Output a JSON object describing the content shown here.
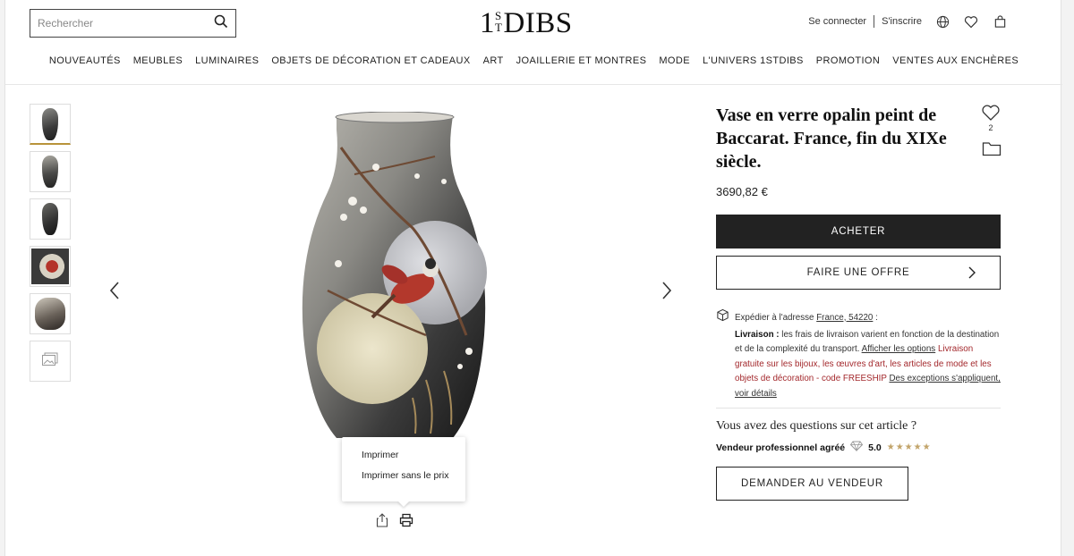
{
  "header": {
    "search_placeholder": "Rechercher",
    "logo": {
      "one": "1",
      "st_top": "S",
      "st_bottom": "T",
      "text": "DIBS"
    },
    "login": "Se connecter",
    "signup": "S'inscrire"
  },
  "nav": [
    "NOUVEAUTÉS",
    "MEUBLES",
    "LUMINAIRES",
    "OBJETS DE DÉCORATION ET CADEAUX",
    "ART",
    "JOAILLERIE ET MONTRES",
    "MODE",
    "L'UNIVERS 1STDIBS",
    "PROMOTION",
    "VENTES AUX ENCHÈRES"
  ],
  "gallery": {
    "print_menu": [
      "Imprimer",
      "Imprimer sans le prix"
    ]
  },
  "product": {
    "title": "Vase en verre opalin peint de Baccarat. France, fin du XIXe siècle.",
    "favorites_count": "2",
    "price": "3690,82 €",
    "buy_label": "ACHETER",
    "offer_label": "FAIRE UNE OFFRE",
    "shipping": {
      "ship_to_prefix": "Expédier à l'adresse",
      "ship_to_link": "France, 54220",
      "ship_to_suffix": ":",
      "delivery_label": "Livraison :",
      "delivery_text": "les frais de livraison varient en fonction de la destination et de la complexité du transport.",
      "options_link": "Afficher les options",
      "free_text": "Livraison gratuite sur les bijoux, les œuvres d'art, les articles de mode et les objets de décoration - code FREESHIP",
      "exceptions_link": "Des exceptions s'appliquent, voir détails"
    },
    "question": "Vous avez des questions sur cet article ?",
    "seller_label": "Vendeur professionnel agréé",
    "seller_rating": "5.0",
    "seller_stars": "★★★★★",
    "ask_label": "DEMANDER AU VENDEUR"
  },
  "colors": {
    "primary_button": "#222222",
    "accent_gold": "#b8933a",
    "promo_red": "#a3282c"
  }
}
